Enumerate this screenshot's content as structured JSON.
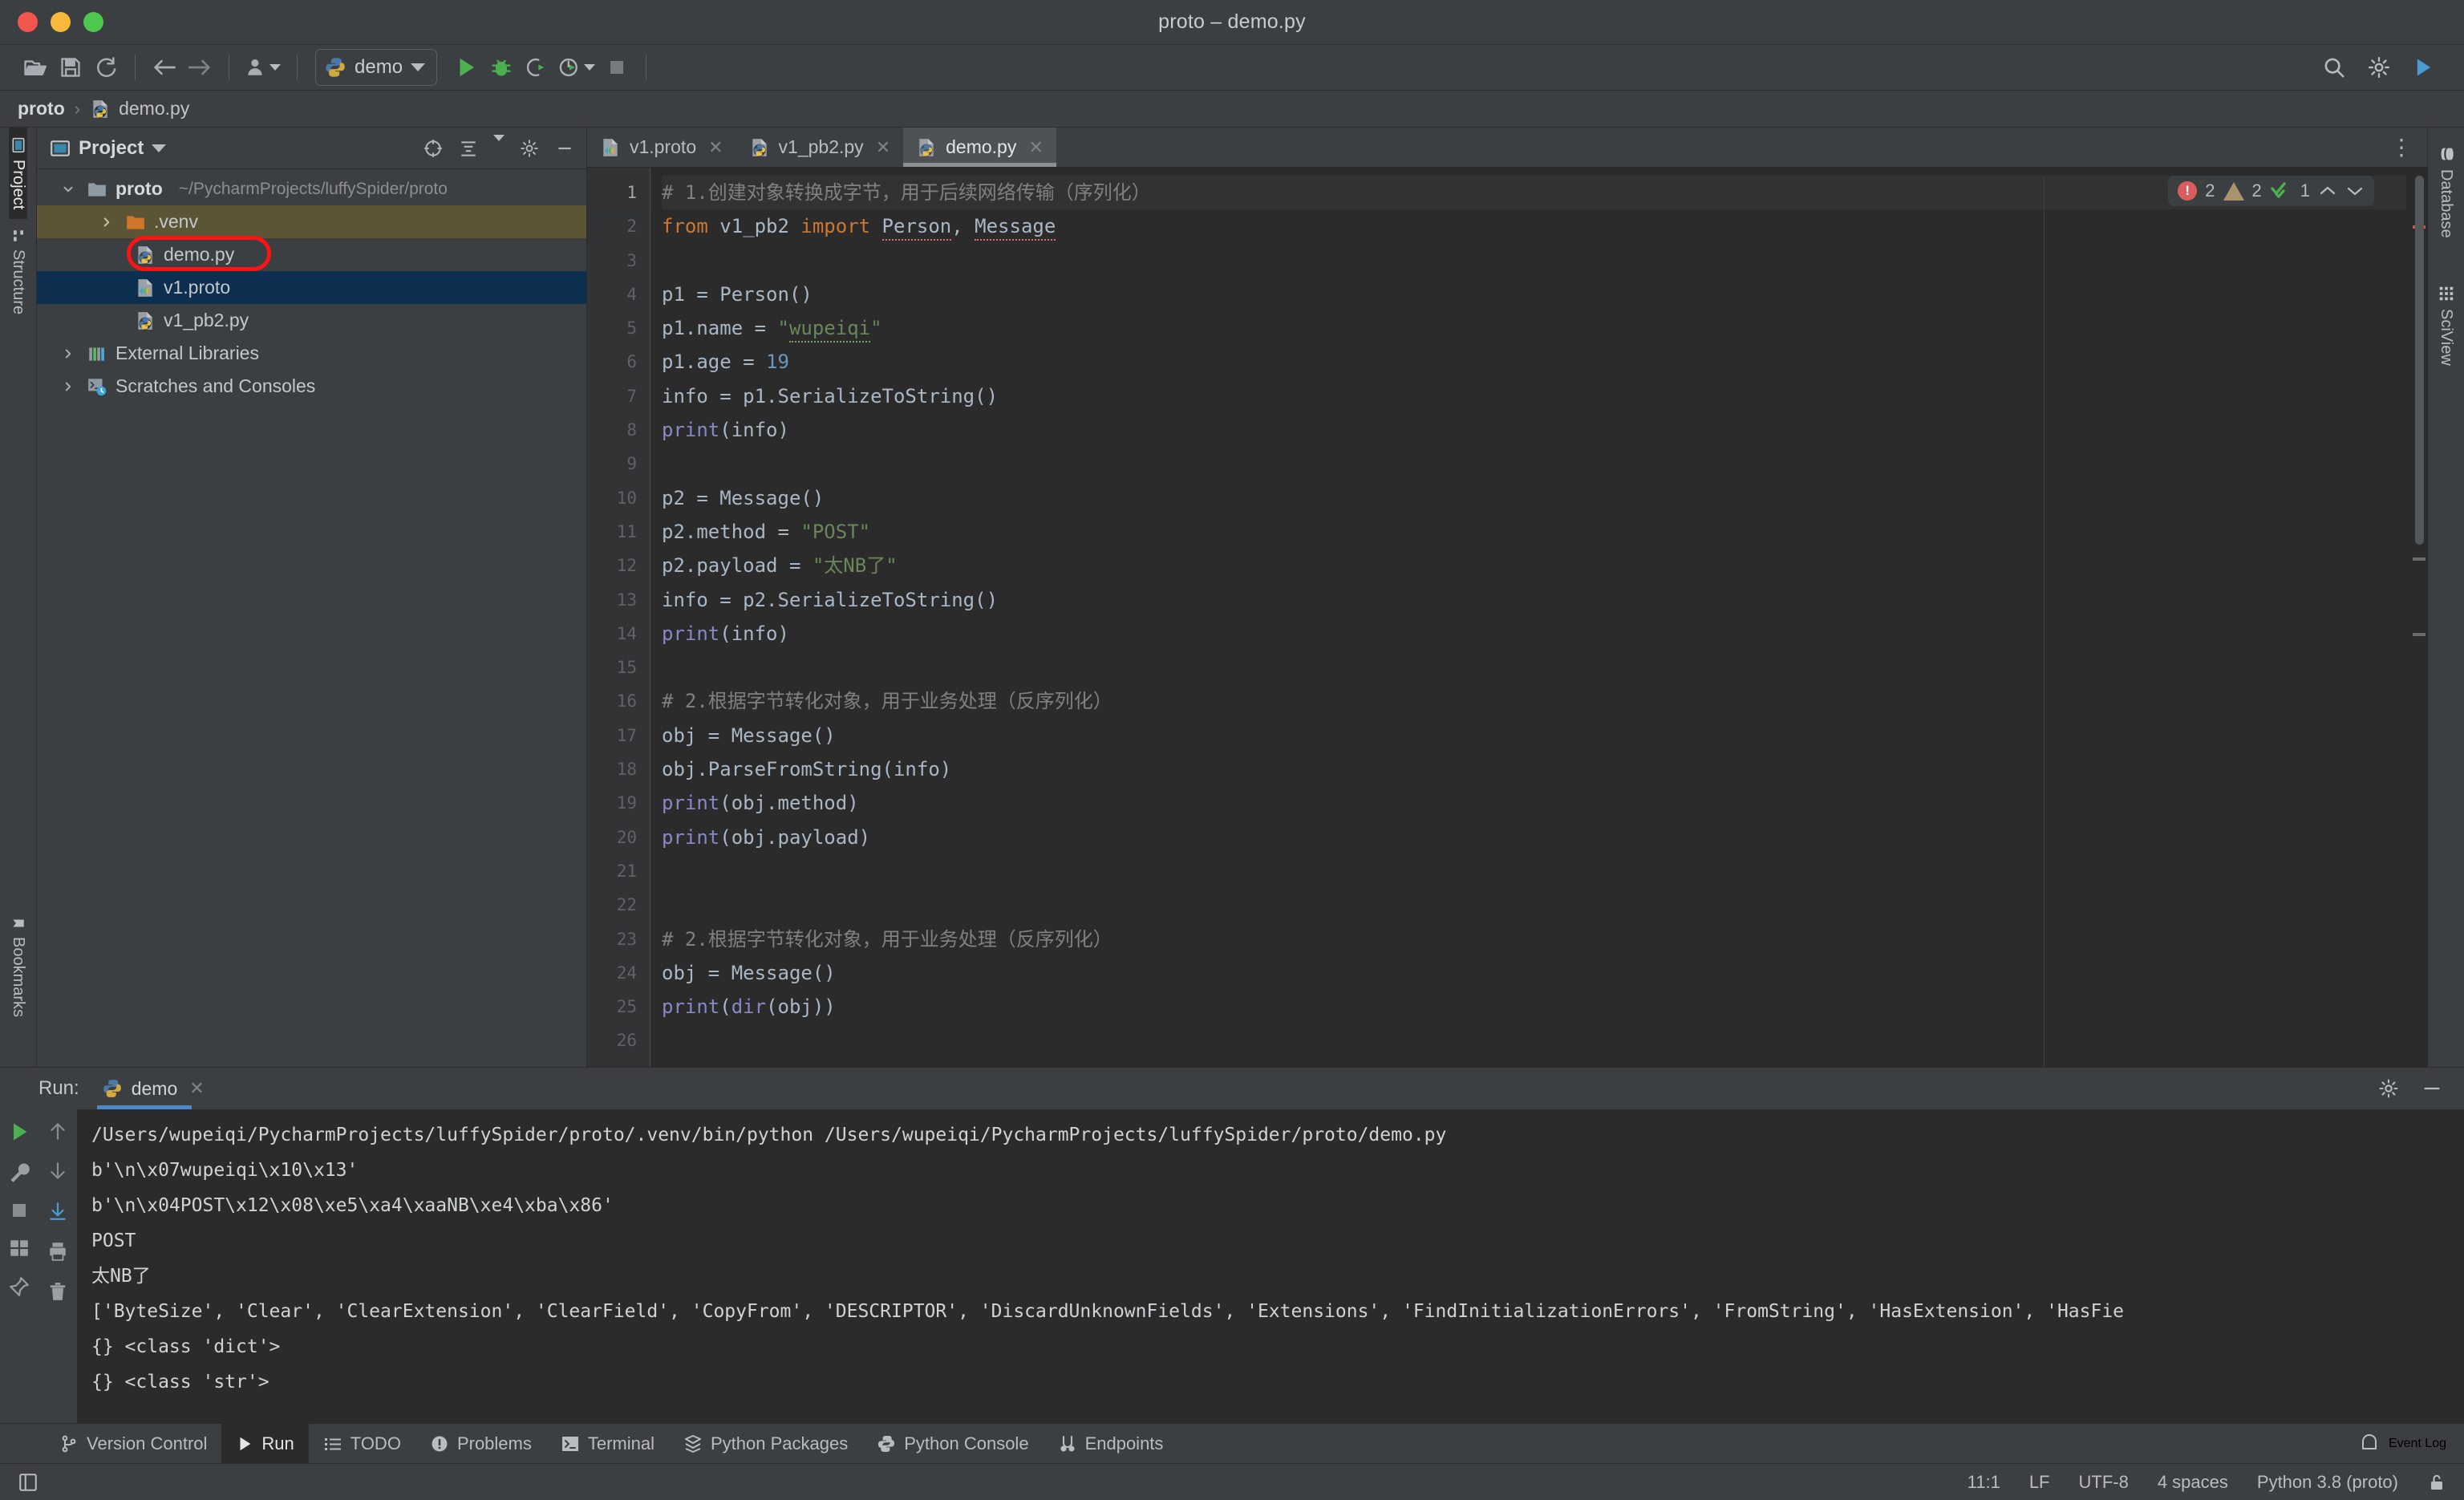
{
  "window": {
    "title": "proto – demo.py"
  },
  "toolbar": {
    "run_config_label": "demo",
    "buttons": [
      {
        "name": "open-folder",
        "icon": "folder-icon"
      },
      {
        "name": "save-all",
        "icon": "save-icon"
      },
      {
        "name": "sync",
        "icon": "refresh-icon"
      },
      {
        "name": "back",
        "icon": "arrow-left-icon"
      },
      {
        "name": "forward",
        "icon": "arrow-right-icon"
      },
      {
        "name": "profile",
        "icon": "user-icon"
      }
    ],
    "run": "run-icon",
    "debug": "debug-icon",
    "coverage": "coverage-icon",
    "profile": "profile-run-icon",
    "stop": "stop-icon",
    "search": "search-icon",
    "settings": "gear-icon",
    "updates": "updates-icon"
  },
  "breadcrumb": {
    "root": "proto",
    "separator": "›",
    "file": "demo.py"
  },
  "left_rail": {
    "project": "Project",
    "structure": "Structure",
    "bookmarks": "Bookmarks"
  },
  "right_rail": {
    "database": "Database",
    "sciview": "SciView"
  },
  "project_panel": {
    "title": "Project",
    "header_icons": [
      "target-icon",
      "collapse-icon",
      "expand-icon",
      "gear-icon",
      "minimize-icon"
    ],
    "tree": [
      {
        "label": "proto",
        "path": "~/PycharmProjects/luffySpider/proto",
        "icon": "folder-icon",
        "twisty": "open",
        "depth": 0,
        "bold": true,
        "state": "normal"
      },
      {
        "label": ".venv",
        "path": "",
        "icon": "folder-orange-icon",
        "twisty": "closed",
        "depth": 1,
        "bold": false,
        "state": "venv"
      },
      {
        "label": "demo.py",
        "path": "",
        "icon": "python-file-icon",
        "twisty": "none",
        "depth": 2,
        "bold": false,
        "state": "annotated"
      },
      {
        "label": "v1.proto",
        "path": "",
        "icon": "proto-file-icon",
        "twisty": "none",
        "depth": 2,
        "bold": false,
        "state": "selected"
      },
      {
        "label": "v1_pb2.py",
        "path": "",
        "icon": "python-file-icon",
        "twisty": "none",
        "depth": 2,
        "bold": false,
        "state": "normal"
      },
      {
        "label": "External Libraries",
        "path": "",
        "icon": "libraries-icon",
        "twisty": "closed",
        "depth": 0,
        "bold": false,
        "state": "normal"
      },
      {
        "label": "Scratches and Consoles",
        "path": "",
        "icon": "scratches-icon",
        "twisty": "closed",
        "depth": 0,
        "bold": false,
        "state": "normal"
      }
    ]
  },
  "editor": {
    "tabs": [
      {
        "label": "v1.proto",
        "icon": "proto-file-icon",
        "active": false
      },
      {
        "label": "v1_pb2.py",
        "icon": "python-file-icon",
        "active": false
      },
      {
        "label": "demo.py",
        "icon": "python-file-icon",
        "active": true
      }
    ],
    "inspection": {
      "errors": "2",
      "warnings": "2",
      "checks": "1",
      "up": "⌃",
      "down": "⌄"
    },
    "lines": [
      {
        "n": "1",
        "text": "# 1.创建对象转换成字节，用于后续网络传输（序列化）"
      },
      {
        "n": "2",
        "text": "from v1_pb2 import Person, Message"
      },
      {
        "n": "3",
        "text": ""
      },
      {
        "n": "4",
        "text": "p1 = Person()"
      },
      {
        "n": "5",
        "text": "p1.name = \"wupeiqi\""
      },
      {
        "n": "6",
        "text": "p1.age = 19"
      },
      {
        "n": "7",
        "text": "info = p1.SerializeToString()"
      },
      {
        "n": "8",
        "text": "print(info)"
      },
      {
        "n": "9",
        "text": ""
      },
      {
        "n": "10",
        "text": "p2 = Message()"
      },
      {
        "n": "11",
        "text": "p2.method = \"POST\""
      },
      {
        "n": "12",
        "text": "p2.payload = \"太NB了\""
      },
      {
        "n": "13",
        "text": "info = p2.SerializeToString()"
      },
      {
        "n": "14",
        "text": "print(info)"
      },
      {
        "n": "15",
        "text": ""
      },
      {
        "n": "16",
        "text": "# 2.根据字节转化对象，用于业务处理（反序列化）"
      },
      {
        "n": "17",
        "text": "obj = Message()"
      },
      {
        "n": "18",
        "text": "obj.ParseFromString(info)"
      },
      {
        "n": "19",
        "text": "print(obj.method)"
      },
      {
        "n": "20",
        "text": "print(obj.payload)"
      },
      {
        "n": "21",
        "text": ""
      },
      {
        "n": "22",
        "text": ""
      },
      {
        "n": "23",
        "text": "# 2.根据字节转化对象，用于业务处理（反序列化）"
      },
      {
        "n": "24",
        "text": "obj = Message()"
      },
      {
        "n": "25",
        "text": "print(dir(obj))"
      },
      {
        "n": "26",
        "text": ""
      }
    ]
  },
  "run_panel": {
    "label": "Run:",
    "tab": "demo",
    "tab_icon": "python-icon",
    "settings_icon": "gear-icon",
    "minimize_icon": "minimize-icon",
    "rail_icons": [
      "rerun-icon",
      "wrench-icon",
      "stop-icon",
      "grid-icon",
      "pin-icon"
    ],
    "rail2_icons": [
      "up-arrow-icon",
      "down-arrow-icon",
      "scroll-end-icon",
      "print-icon",
      "trash-icon"
    ],
    "output": [
      "/Users/wupeiqi/PycharmProjects/luffySpider/proto/.venv/bin/python /Users/wupeiqi/PycharmProjects/luffySpider/proto/demo.py",
      "b'\\n\\x07wupeiqi\\x10\\x13'",
      "b'\\n\\x04POST\\x12\\x08\\xe5\\xa4\\xaaNB\\xe4\\xba\\x86'",
      "POST",
      "太NB了",
      "['ByteSize', 'Clear', 'ClearExtension', 'ClearField', 'CopyFrom', 'DESCRIPTOR', 'DiscardUnknownFields', 'Extensions', 'FindInitializationErrors', 'FromString', 'HasExtension', 'HasFie",
      "{} <class 'dict'>",
      "{} <class 'str'>"
    ]
  },
  "toolwindow_bar": {
    "items": [
      {
        "label": "Version Control",
        "icon": "branch-icon",
        "active": false
      },
      {
        "label": "Run",
        "icon": "run-icon",
        "active": true
      },
      {
        "label": "TODO",
        "icon": "list-icon",
        "active": false
      },
      {
        "label": "Problems",
        "icon": "problems-icon",
        "active": false
      },
      {
        "label": "Terminal",
        "icon": "terminal-icon",
        "active": false
      },
      {
        "label": "Python Packages",
        "icon": "packages-icon",
        "active": false
      },
      {
        "label": "Python Console",
        "icon": "python-icon",
        "active": false
      },
      {
        "label": "Endpoints",
        "icon": "endpoints-icon",
        "active": false
      }
    ],
    "event_log": "Event Log",
    "event_log_icon": "event-log-icon"
  },
  "statusbar": {
    "layout_icon": "layout-icon",
    "caret": "11:1",
    "line_sep": "LF",
    "encoding": "UTF-8",
    "indent": "4 spaces",
    "interpreter": "Python 3.8 (proto)",
    "lock_icon": "lock-icon"
  },
  "colors": {
    "chrome": "#3c3f41",
    "editor_bg": "#2b2b2b",
    "accent_blue": "#4a88c7",
    "selection": "#0d2f4f",
    "venv_highlight": "#5b5536",
    "annotation_red": "#fb1414",
    "keyword_orange": "#cc7832",
    "string_green": "#6a8759",
    "number_blue": "#6897bb",
    "builtin_purple": "#8888c6",
    "comment_gray": "#808080"
  }
}
